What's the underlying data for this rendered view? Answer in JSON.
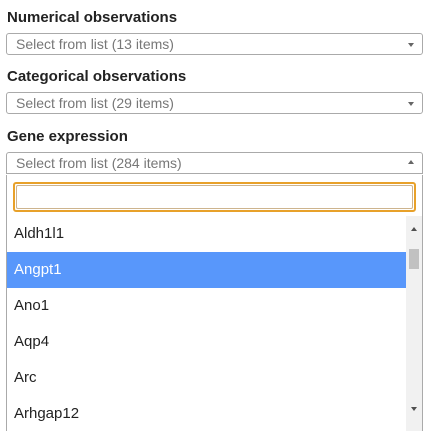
{
  "numerical": {
    "label": "Numerical observations",
    "placeholder": "Select from list (13 items)"
  },
  "categorical": {
    "label": "Categorical observations",
    "placeholder": "Select from list (29 items)"
  },
  "gene_expression": {
    "label": "Gene expression",
    "placeholder": "Select from list (284 items)",
    "search_value": "",
    "options": [
      "Aldh1l1",
      "Angpt1",
      "Ano1",
      "Aqp4",
      "Arc",
      "Arhgap12"
    ],
    "highlighted_index": 1
  },
  "colors": {
    "highlight": "#5897fb",
    "search_focus_border": "#e8a12a",
    "select_border": "#aaaaaa"
  }
}
